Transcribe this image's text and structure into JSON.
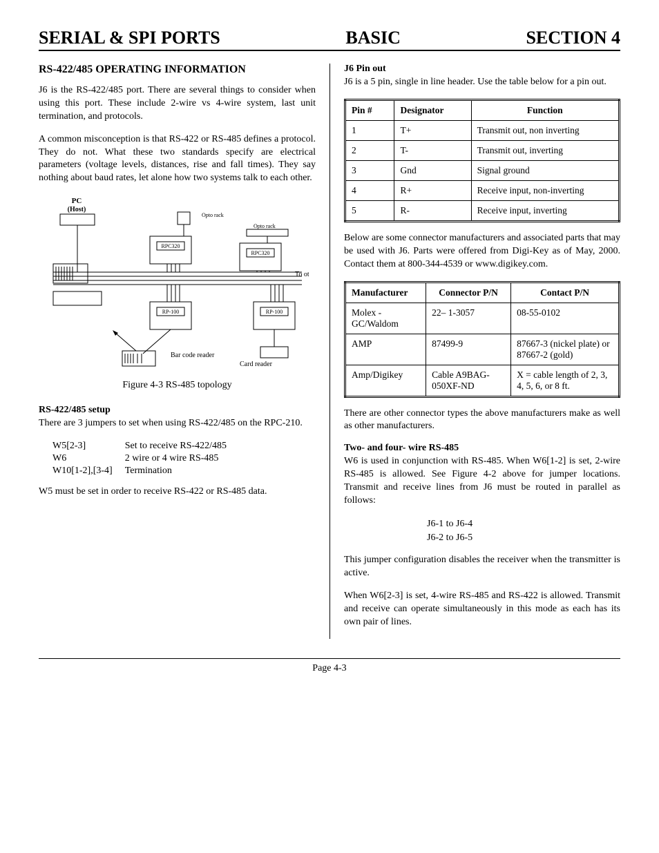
{
  "header": {
    "left": "SERIAL & SPI PORTS",
    "center": "BASIC",
    "right": "SECTION 4"
  },
  "left": {
    "title": "RS-422/485 OPERATING INFORMATION",
    "p1": "J6 is the RS-422/485 port. There are several things to consider when using this port. These include 2-wire vs 4-wire system, last unit termination, and protocols.",
    "p2": "A common misconception is that RS-422 or RS-485 defines a protocol. They do not. What these two standards specify are electrical parameters (voltage levels, distances, rise and fall times). They say nothing about baud rates, let alone how two systems talk to each other.",
    "figure": {
      "labels": {
        "pc": "PC",
        "host": "(Host)",
        "opto": "Opto rack",
        "rpc320a": "RPC320",
        "rpc320b": "RPC320",
        "other": "To other devices",
        "rp100a": "RP-100",
        "rp100b": "RP-100",
        "barcode": "Bar code reader",
        "card": "Card reader"
      },
      "caption": "Figure 4-3 RS-485 topology"
    },
    "setup": {
      "head": "RS-422/485 setup",
      "intro": "There are 3 jumpers to set when using RS-422/485 on the RPC-210.",
      "rows": [
        {
          "a": "W5[2-3]",
          "b": "Set to receive RS-422/485"
        },
        {
          "a": "W6",
          "b": "2 wire or 4 wire RS-485"
        },
        {
          "a": "W10[1-2],[3-4]",
          "b": "Termination"
        }
      ],
      "note": "W5 must be set in order to receive RS-422 or RS-485 data."
    }
  },
  "right": {
    "pinout": {
      "head": "J6 Pin out",
      "intro": "J6 is a 5 pin, single in line header. Use the table below for a pin out.",
      "headers": {
        "a": "Pin #",
        "b": "Designator",
        "c": "Function"
      },
      "rows": [
        {
          "a": "1",
          "b": "T+",
          "c": "Transmit out, non inverting"
        },
        {
          "a": "2",
          "b": "T-",
          "c": "Transmit out, inverting"
        },
        {
          "a": "3",
          "b": "Gnd",
          "c": "Signal ground"
        },
        {
          "a": "4",
          "b": "R+",
          "c": "Receive input, non-inverting"
        },
        {
          "a": "5",
          "b": "R-",
          "c": "Receive input, inverting"
        }
      ]
    },
    "conn": {
      "intro": "Below are some connector manufacturers and associated parts that may be used with J6. Parts were offered from Digi-Key as of May, 2000. Contact them at 800-344-4539 or www.digikey.com.",
      "headers": {
        "a": "Manufacturer",
        "b": "Connector P/N",
        "c": "Contact P/N"
      },
      "rows": [
        {
          "a": "Molex - GC/Waldom",
          "b": "22– 1-3057",
          "c": "08-55-0102"
        },
        {
          "a": "AMP",
          "b": "87499-9",
          "c": "87667-3 (nickel plate) or 87667-2 (gold)"
        },
        {
          "a": "Amp/Digikey",
          "b": "Cable A9BAG-050XF-ND",
          "c": "X = cable length of 2, 3, 4, 5, 6, or 8 ft."
        }
      ],
      "note": "There are other connector types the above manufacturers make as well as other manufacturers."
    },
    "wire": {
      "head": "Two- and four- wire RS-485",
      "p1": "W6 is used in conjunction with RS-485. When W6[1-2] is set, 2-wire RS-485 is allowed. See Figure 4-2 above for jumper locations. Transmit and receive lines from J6 must be routed in parallel as follows:",
      "r1": "J6-1 to J6-4",
      "r2": "J6-2 to J6-5",
      "p2": "This jumper configuration disables the receiver when the transmitter is active.",
      "p3": "When W6[2-3] is set, 4-wire RS-485 and RS-422 is allowed. Transmit and receive can operate simultaneously in this mode as each has its own pair of lines."
    }
  },
  "footer": "Page 4-3"
}
